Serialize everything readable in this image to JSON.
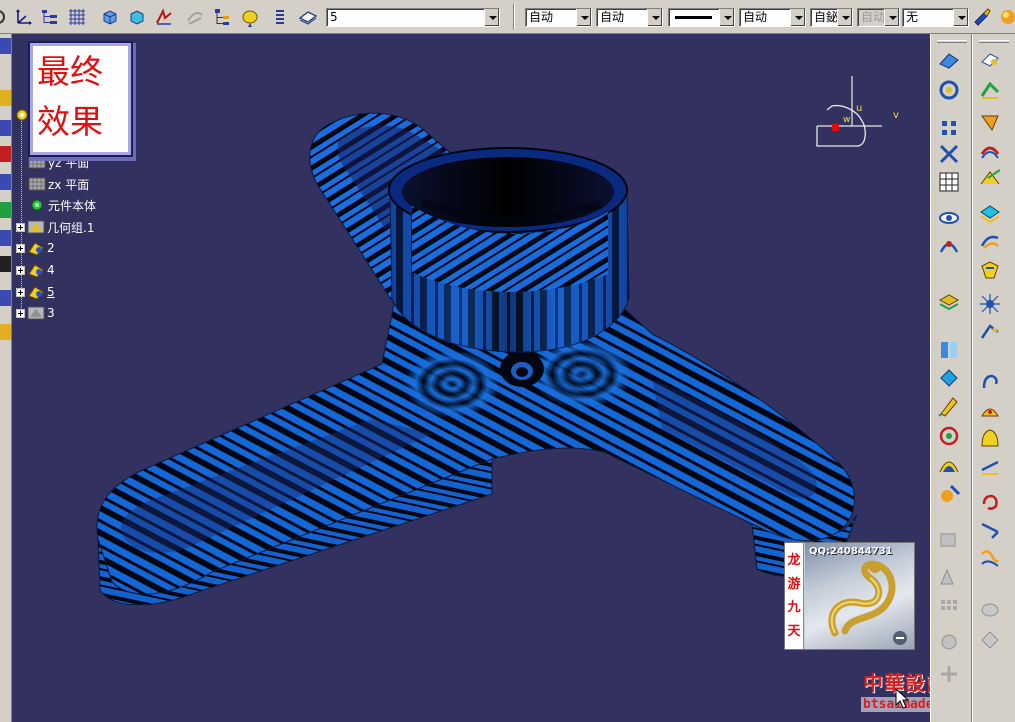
{
  "toolbar": {
    "layer_combo": "5",
    "combo_color": "自动",
    "combo_color2": "自动",
    "combo_thickness": "自动",
    "combo_linetype": "自鉍",
    "combo_disabled": "自动",
    "combo_layer": "无"
  },
  "final_label": {
    "line1": "最终",
    "line2": "效果"
  },
  "tree": {
    "items": [
      {
        "label": "yz 平面"
      },
      {
        "label": "zx 平面"
      },
      {
        "label": "元件本体"
      },
      {
        "label": "几何组.1"
      },
      {
        "label": "2"
      },
      {
        "label": "4"
      },
      {
        "label": "5"
      },
      {
        "label": "3"
      }
    ]
  },
  "compass": {
    "u_label": "u",
    "v_label": "v",
    "w_label": "w"
  },
  "dragon_widget": {
    "qq": "QQ:240844731",
    "vertical_text": [
      "龙",
      "游",
      "九",
      "天"
    ]
  },
  "watermark": {
    "text": "中華設計論壇",
    "url": "btsaimade.net"
  },
  "colors": {
    "viewport_bg": "#33315f",
    "model_blue": "#1565d8",
    "stripe_dark": "#020612",
    "chrome": "#d4d0c8"
  }
}
